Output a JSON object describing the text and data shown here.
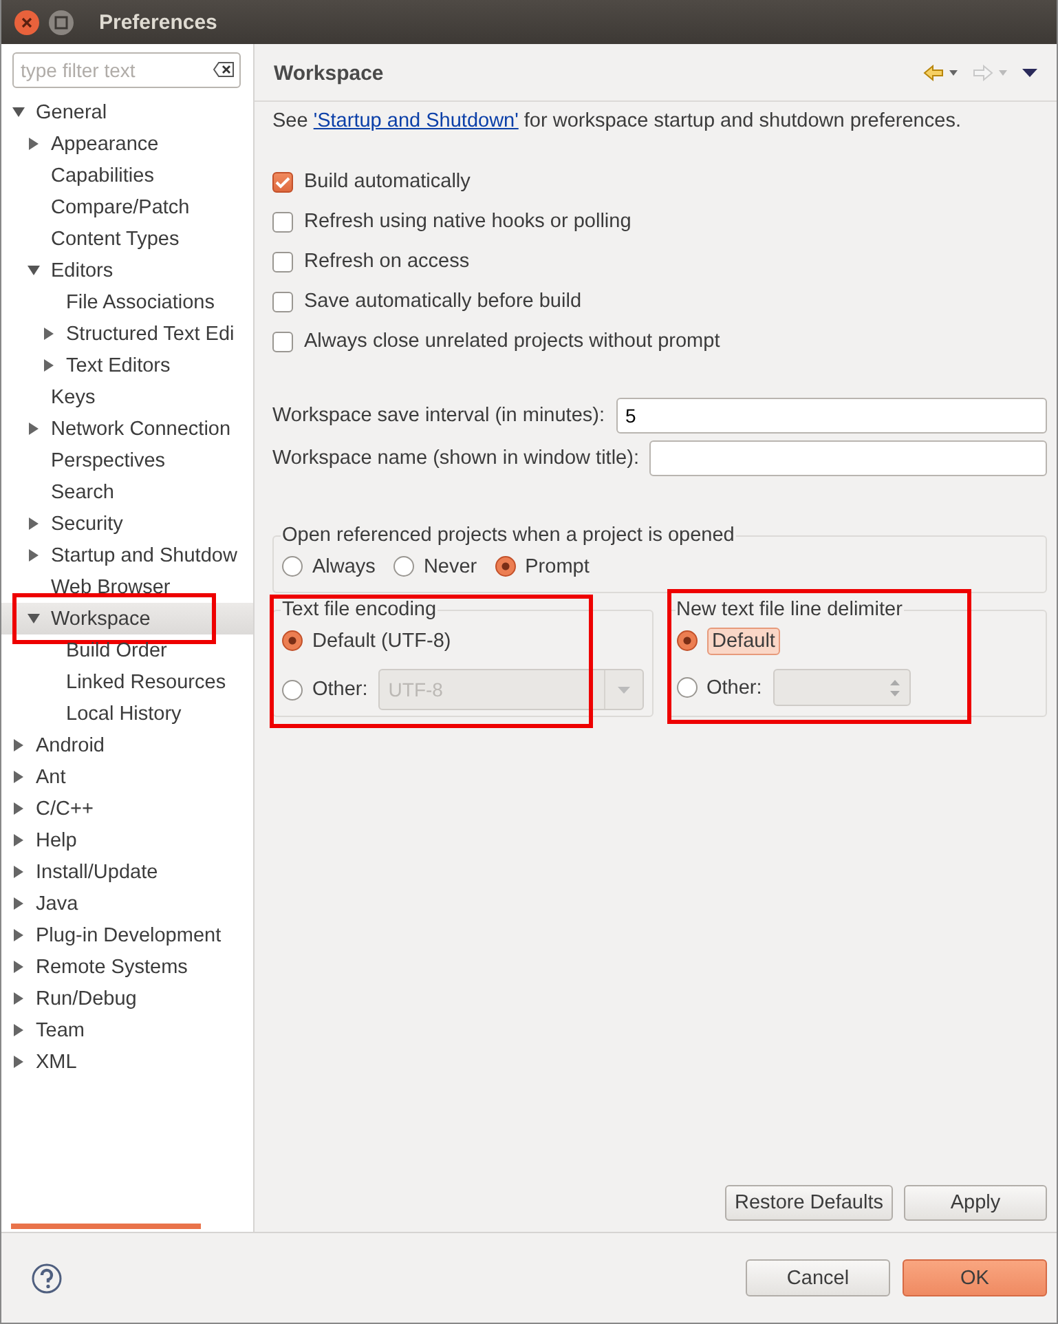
{
  "window": {
    "title": "Preferences"
  },
  "filter": {
    "placeholder": "type filter text"
  },
  "tree": [
    {
      "label": "General",
      "expanded": true,
      "selected": false,
      "children": [
        {
          "label": "Appearance",
          "expanded": false,
          "selected": false
        },
        {
          "label": "Capabilities",
          "selected": false
        },
        {
          "label": "Compare/Patch",
          "selected": false
        },
        {
          "label": "Content Types",
          "selected": false
        },
        {
          "label": "Editors",
          "expanded": true,
          "selected": false,
          "children": [
            {
              "label": "File Associations",
              "selected": false
            },
            {
              "label": "Structured Text Edi",
              "expanded": false,
              "selected": false
            },
            {
              "label": "Text Editors",
              "expanded": false,
              "selected": false
            }
          ]
        },
        {
          "label": "Keys",
          "selected": false
        },
        {
          "label": "Network Connection",
          "expanded": false,
          "selected": false
        },
        {
          "label": "Perspectives",
          "selected": false
        },
        {
          "label": "Search",
          "selected": false
        },
        {
          "label": "Security",
          "expanded": false,
          "selected": false
        },
        {
          "label": "Startup and Shutdow",
          "expanded": false,
          "selected": false
        },
        {
          "label": "Web Browser",
          "selected": false
        },
        {
          "label": "Workspace",
          "expanded": true,
          "selected": true,
          "highlighted": true,
          "children": [
            {
              "label": "Build Order",
              "selected": false
            },
            {
              "label": "Linked Resources",
              "selected": false
            },
            {
              "label": "Local History",
              "selected": false
            }
          ]
        }
      ]
    },
    {
      "label": "Android",
      "expanded": false,
      "selected": false
    },
    {
      "label": "Ant",
      "expanded": false,
      "selected": false
    },
    {
      "label": "C/C++",
      "expanded": false,
      "selected": false
    },
    {
      "label": "Help",
      "expanded": false,
      "selected": false
    },
    {
      "label": "Install/Update",
      "expanded": false,
      "selected": false
    },
    {
      "label": "Java",
      "expanded": false,
      "selected": false
    },
    {
      "label": "Plug-in Development",
      "expanded": false,
      "selected": false
    },
    {
      "label": "Remote Systems",
      "expanded": false,
      "selected": false
    },
    {
      "label": "Run/Debug",
      "expanded": false,
      "selected": false
    },
    {
      "label": "Team",
      "expanded": false,
      "selected": false
    },
    {
      "label": "XML",
      "expanded": false,
      "selected": false
    }
  ],
  "page": {
    "title": "Workspace",
    "intro": {
      "before": "See ",
      "link": "'Startup and Shutdown'",
      "after": " for workspace startup and shutdown preferences."
    },
    "checkboxes": [
      {
        "label": "Build automatically",
        "checked": true
      },
      {
        "label": "Refresh using native hooks or polling",
        "checked": false
      },
      {
        "label": "Refresh on access",
        "checked": false
      },
      {
        "label": "Save automatically before build",
        "checked": false
      },
      {
        "label": "Always close unrelated projects without prompt",
        "checked": false
      }
    ],
    "fields": [
      {
        "label": "Workspace save interval (in minutes):",
        "value": "5"
      },
      {
        "label": "Workspace name (shown in window title):"
      }
    ],
    "open_referenced": {
      "title": "Open referenced projects when a project is opened",
      "options": [
        {
          "label": "Always",
          "selected": false
        },
        {
          "label": "Never",
          "selected": false
        },
        {
          "label": "Prompt",
          "selected": true
        }
      ]
    },
    "encoding": {
      "title": "Text file encoding",
      "highlighted": true,
      "options": [
        {
          "label": "Default (UTF-8)",
          "selected": true
        },
        {
          "label": "Other:",
          "selected": false
        }
      ],
      "combo": {
        "value": "UTF-8",
        "disabled": true
      }
    },
    "delimiter": {
      "title": "New text file line delimiter",
      "highlighted": true,
      "options": [
        {
          "label": "Default",
          "selected": true,
          "focused": true
        },
        {
          "label": "Other:",
          "selected": false
        }
      ],
      "combo": {
        "disabled": true
      }
    },
    "buttons": [
      "Restore Defaults",
      "Apply"
    ]
  },
  "dialog_buttons": [
    {
      "label": "Cancel",
      "default": false
    },
    {
      "label": "OK",
      "default": true
    }
  ]
}
